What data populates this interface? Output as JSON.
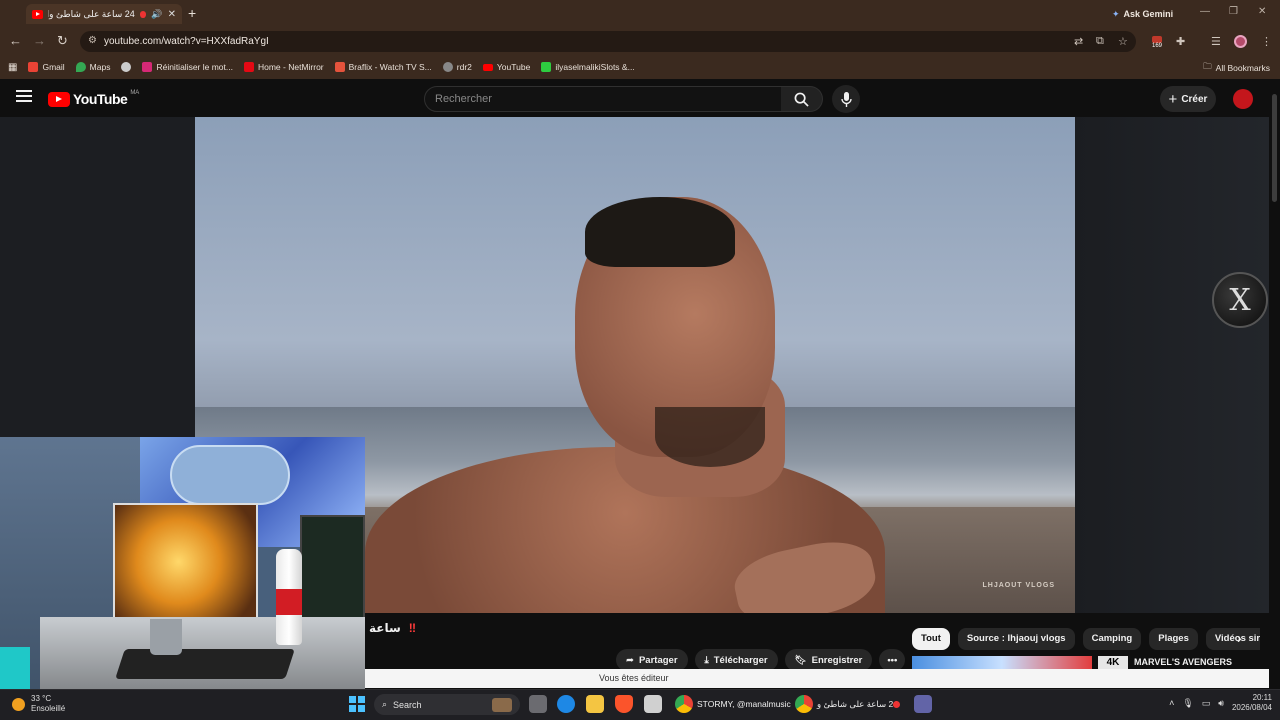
{
  "browser": {
    "tab": {
      "title": "24 ساعة على شاطئ واد"
    },
    "gemini_label": "Ask Gemini",
    "url": "youtube.com/watch?v=HXXfadRaYgI",
    "extension_badge": "169",
    "bookmarks": [
      {
        "label": "Gmail",
        "color": "#ea4335"
      },
      {
        "label": "Maps",
        "color": "#34a853"
      },
      {
        "label": "",
        "color": "#cccccc"
      },
      {
        "label": "Réinitialiser le mot...",
        "color": "#d62976"
      },
      {
        "label": "Home - NetMirror",
        "color": "#e50914"
      },
      {
        "label": "Braflix - Watch TV S...",
        "color": "#e5533c"
      },
      {
        "label": "rdr2",
        "color": "#888888"
      },
      {
        "label": "YouTube",
        "color": "#ff0000"
      },
      {
        "label": "ilyaselmalikiSlots &...",
        "color": "#2ecc40"
      }
    ],
    "all_bookmarks": "All Bookmarks"
  },
  "youtube": {
    "logo_text": "YouTube",
    "country_code": "MA",
    "search_placeholder": "Rechercher",
    "create_label": "Créer",
    "video_watermark": "LHJAOUT VLOGS",
    "title_fragment": "ساعة",
    "title_mark": "‼",
    "chips": [
      "Tout",
      "Source : Ihjaouj vlogs",
      "Camping",
      "Plages",
      "Vidéos sir"
    ],
    "actions": {
      "share": "Partager",
      "download": "Télécharger",
      "save": "Enregistrer"
    },
    "recommended_badge": "4K",
    "recommended_title": "MARVEL'S AVENGERS",
    "editor_notice": "Vous êtes éditeur"
  },
  "taskbar": {
    "weather_temp": "33 °C",
    "weather_label": "Ensoleillé",
    "search_label": "Search",
    "app_label_1": "STORMY, @manalmusic",
    "app_label_2": "24 ساعة على شاطئ و",
    "time": "20:11",
    "date": "2026/08/04"
  },
  "colors": {
    "chrome_bg": "#3b2a1f",
    "yt_bg": "#0f0f0f",
    "yt_red": "#ff0000"
  }
}
